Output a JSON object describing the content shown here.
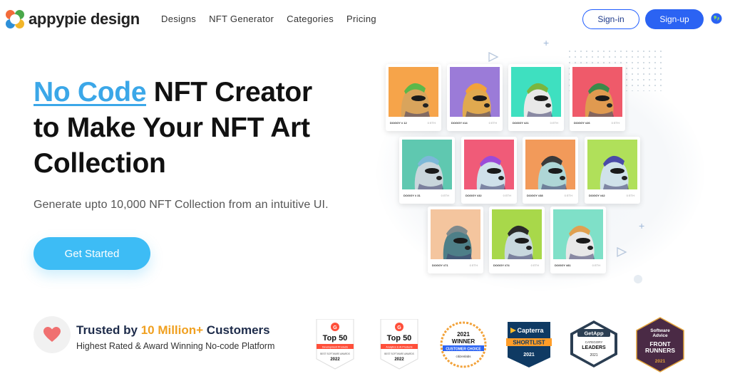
{
  "header": {
    "logo_text": "appypie design",
    "nav": [
      "Designs",
      "NFT Generator",
      "Categories",
      "Pricing"
    ],
    "signin_label": "Sign-in",
    "signup_label": "Sign-up"
  },
  "hero": {
    "title_highlight": "No Code",
    "title_rest_1": " NFT Creator",
    "title_line_2": "to Make Your NFT Art",
    "title_line_3": "Collection",
    "subtitle": "Generate upto 10,000 NFT Collection from an intuitive UI.",
    "cta_label": "Get Started"
  },
  "trust": {
    "title_prefix": "Trusted by ",
    "title_accent": "10 Million+",
    "title_suffix": " Customers",
    "subtitle": "Highest Rated & Award Winning No-code Platform"
  },
  "badges": [
    {
      "name": "G2 Top 50 Development Products 2022",
      "line1": "Top 50",
      "line2": "Development Products",
      "line3": "BEST SOFTWARE AWARDS",
      "year": "2022"
    },
    {
      "name": "G2 Top 50 Analytics & AI Products 2022",
      "line1": "Top 50",
      "line2": "Analytics & AI Products",
      "line3": "BEST SOFTWARE AWARDS",
      "year": "2022"
    },
    {
      "name": "Softwareadvice Winner Customer Choice 2021",
      "year": "2021",
      "line1": "WINNER",
      "line2": "CUSTOMER CHOICE",
      "line3": "citizenlabs"
    },
    {
      "name": "Capterra Shortlist 2021",
      "line1": "Capterra",
      "line2": "SHORTLIST",
      "year": "2021"
    },
    {
      "name": "GetApp Category Leaders 2021",
      "line1": "GetApp",
      "line2": "CATEGORY",
      "line3": "LEADERS",
      "year": "2021"
    },
    {
      "name": "Software Advice Front Runners 2021",
      "line1": "Software",
      "line2": "Advice",
      "line3": "FRONT",
      "line4": "RUNNERS",
      "year": "2021"
    }
  ],
  "gallery": [
    {
      "caption": "DOGGY # 12",
      "price": "0 ETH",
      "bg": "#f6a44a",
      "hat": "#5bb84a",
      "face": "#d9a45c"
    },
    {
      "caption": "DOGGY #14",
      "price": "0 ETH",
      "bg": "#9b7bd8",
      "hat": "#f2a23a",
      "face": "#e0a94f"
    },
    {
      "caption": "DOGGY #21",
      "price": "0 ETH",
      "bg": "#3ee0c0",
      "hat": "#7ab63e",
      "face": "#e8e8e8"
    },
    {
      "caption": "DOGGY #26",
      "price": "0 ETH",
      "bg": "#ef5a6a",
      "hat": "#3a8a4a",
      "face": "#e09a50"
    },
    {
      "caption": "DOGGY # 31",
      "price": "0 ETH",
      "bg": "#5fc8b0",
      "hat": "#7cb8d8",
      "face": "#c9d6dc"
    },
    {
      "caption": "DOGGY #32",
      "price": "0 ETH",
      "bg": "#f05b78",
      "hat": "#9b4bd8",
      "face": "#cfe0ea"
    },
    {
      "caption": "DOGGY #38",
      "price": "0 ETH",
      "bg": "#f29a5a",
      "hat": "#3a3a3a",
      "face": "#aed6d6"
    },
    {
      "caption": "DOGGY #42",
      "price": "0 ETH",
      "bg": "#b0e05a",
      "hat": "#4a4aa8",
      "face": "#d0e2ea"
    },
    {
      "caption": "DOGGY #71",
      "price": "0 ETH",
      "bg": "#f4c59e",
      "hat": "#7f8a8c",
      "face": "#4e7f88"
    },
    {
      "caption": "DOGGY #74",
      "price": "0 ETH",
      "bg": "#a8d84a",
      "hat": "#2a2a2a",
      "face": "#c8d8de"
    },
    {
      "caption": "DOGGY #81",
      "price": "0 ETH",
      "bg": "#7fe0c8",
      "hat": "#e0a050",
      "face": "#e8e8e8"
    }
  ]
}
